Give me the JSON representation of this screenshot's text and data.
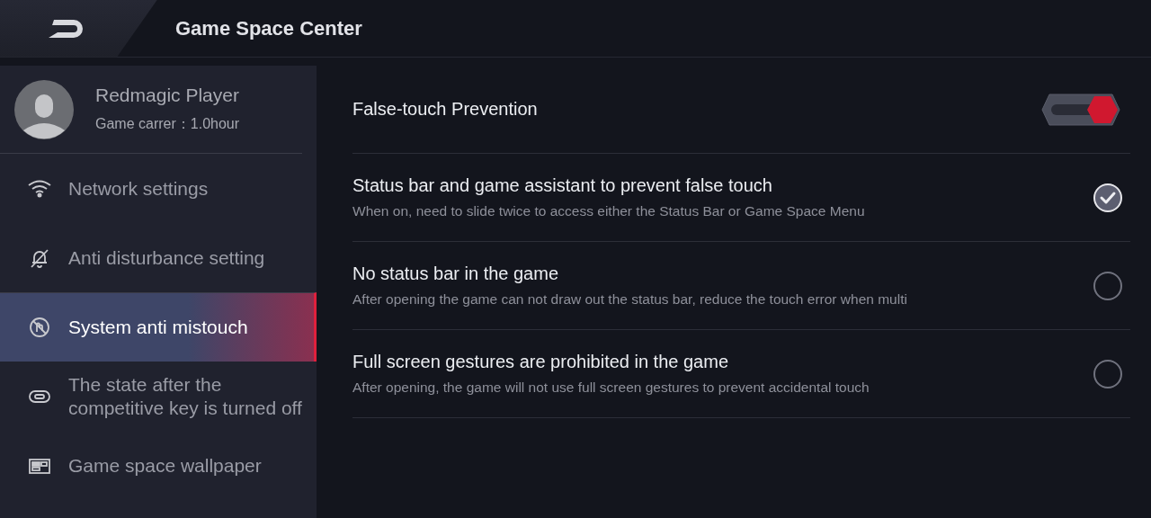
{
  "header": {
    "title": "Game Space Center"
  },
  "profile": {
    "name": "Redmagic Player",
    "subtitle": "Game carrer：1.0hour"
  },
  "sidebar": {
    "items": [
      {
        "label": "Network settings",
        "selected": false
      },
      {
        "label": "Anti disturbance setting",
        "selected": false
      },
      {
        "label": "System anti mistouch",
        "selected": true
      },
      {
        "label": "The state after the competitive key is turned off",
        "selected": false
      },
      {
        "label": "Game space wallpaper",
        "selected": false
      }
    ]
  },
  "settings": [
    {
      "kind": "toggle",
      "title": "False-touch Prevention",
      "on": true
    },
    {
      "kind": "check",
      "title": "Status bar and game assistant to prevent false touch",
      "description": "When on, need to slide twice to access either the Status Bar or Game Space Menu",
      "checked": true
    },
    {
      "kind": "check",
      "title": "No status bar in the game",
      "description": "After opening the game can not draw out the status bar, reduce the touch error when multi",
      "checked": false
    },
    {
      "kind": "check",
      "title": "Full screen gestures are prohibited in the game",
      "description": "After opening, the game will not use full screen gestures to prevent accidental touch",
      "checked": false
    }
  ]
}
